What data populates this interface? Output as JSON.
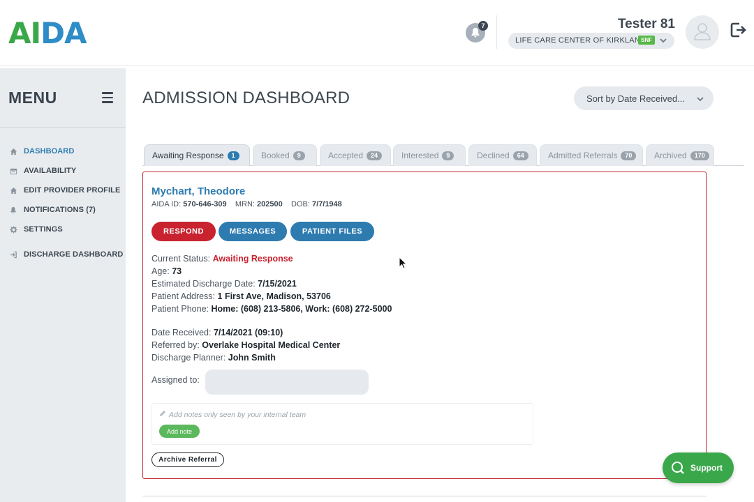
{
  "header": {
    "logo": [
      "A",
      "I",
      "D",
      "A"
    ],
    "notification_count": "7",
    "user_name": "Tester 81",
    "facility_name": "LIFE CARE CENTER OF KIRKLAND",
    "facility_badge": "SNF",
    "icons": {
      "bell": "bell-icon",
      "avatar": "user-avatar-icon",
      "logout": "logout-icon"
    }
  },
  "sidebar": {
    "title": "MENU",
    "items": [
      {
        "label": "DASHBOARD",
        "icon": "home-icon",
        "active": true
      },
      {
        "label": "AVAILABILITY",
        "icon": "calendar-icon"
      },
      {
        "label": "EDIT PROVIDER PROFILE",
        "icon": "home-icon"
      },
      {
        "label": "NOTIFICATIONS (7)",
        "icon": "bell-icon"
      },
      {
        "label": "SETTINGS",
        "icon": "gear-icon"
      },
      {
        "label": "DISCHARGE DASHBOARD",
        "icon": "sign-in-icon"
      }
    ]
  },
  "main": {
    "title": "ADMISSION DASHBOARD",
    "sort_label": "Sort by Date Received...",
    "tabs": [
      {
        "label": "Awaiting Response",
        "count": "1"
      },
      {
        "label": "Booked",
        "count": "9"
      },
      {
        "label": "Accepted",
        "count": "24"
      },
      {
        "label": "Interested",
        "count": "9"
      },
      {
        "label": "Declined",
        "count": "64"
      },
      {
        "label": "Admitted Referrals",
        "count": "70"
      },
      {
        "label": "Archived",
        "count": "170"
      }
    ]
  },
  "referral": {
    "patient_name": "Mychart, Theodore",
    "aida_id_label": "AIDA ID:",
    "aida_id": "570-646-309",
    "mrn_label": "MRN:",
    "mrn": "202500",
    "dob_label": "DOB:",
    "dob": "7/7/1948",
    "buttons": {
      "respond": "RESPOND",
      "messages": "MESSAGES",
      "files": "PATIENT FILES"
    },
    "status_label": "Current Status:",
    "status": "Awaiting Response",
    "age_label": "Age:",
    "age": "73",
    "discharge_label": "Estimated Discharge Date:",
    "discharge_date": "7/15/2021",
    "address_label": "Patient Address:",
    "address": "1 First Ave, Madison, 53706",
    "phone_label": "Patient Phone:",
    "phone": "Home: (608) 213-5806, Work: (608) 272-5000",
    "received_label": "Date Received:",
    "received": "7/14/2021 (09:10)",
    "referred_label": "Referred by:",
    "referred_by": "Overlake Hospital Medical Center",
    "planner_label": "Discharge Planner:",
    "planner": "John Smith",
    "assigned_label": "Assigned to:",
    "notes_placeholder": "Add notes only seen by your internal team",
    "add_note": "Add note",
    "archive": "Archive Referral"
  },
  "support": {
    "label": "Support",
    "icon": "chat-search-icon"
  },
  "colors": {
    "brand_green": "#3aa84a",
    "brand_blue": "#2e7bb0",
    "alert_red": "#c8232f"
  }
}
